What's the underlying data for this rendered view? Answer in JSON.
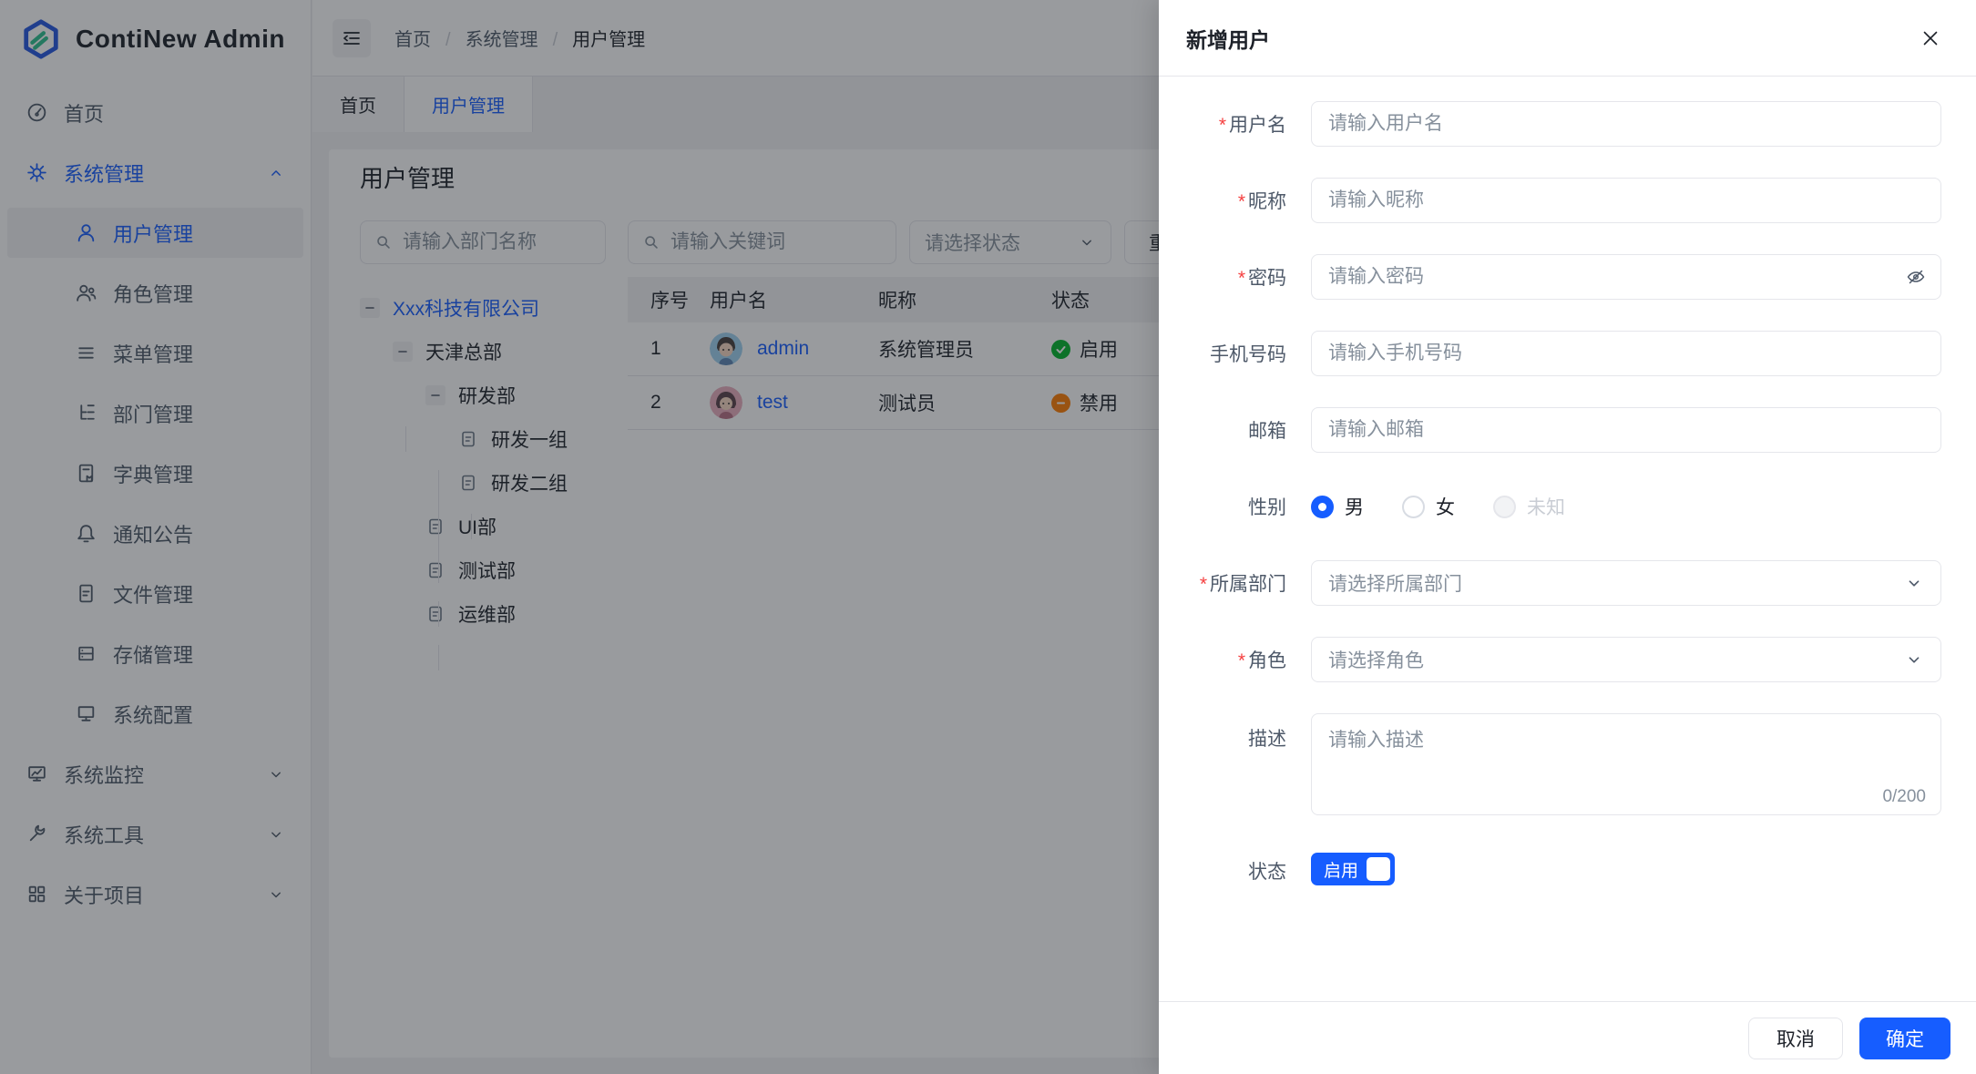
{
  "app": {
    "title": "ContiNew Admin"
  },
  "colors": {
    "primary": "#165DFF",
    "success": "#00B42A",
    "warning": "#FF7D00",
    "danger": "#F53F3F"
  },
  "sidebar": {
    "items": [
      {
        "label": "首页"
      },
      {
        "label": "系统管理"
      },
      {
        "label": "用户管理"
      },
      {
        "label": "角色管理"
      },
      {
        "label": "菜单管理"
      },
      {
        "label": "部门管理"
      },
      {
        "label": "字典管理"
      },
      {
        "label": "通知公告"
      },
      {
        "label": "文件管理"
      },
      {
        "label": "存储管理"
      },
      {
        "label": "系统配置"
      },
      {
        "label": "系统监控"
      },
      {
        "label": "系统工具"
      },
      {
        "label": "关于项目"
      }
    ]
  },
  "header": {
    "breadcrumb": [
      "首页",
      "系统管理",
      "用户管理"
    ]
  },
  "tabs": [
    {
      "label": "首页"
    },
    {
      "label": "用户管理"
    }
  ],
  "page": {
    "title": "用户管理",
    "dept_search_placeholder": "请输入部门名称",
    "tree": [
      {
        "label": "Xxx科技有限公司"
      },
      {
        "label": "天津总部"
      },
      {
        "label": "研发部"
      },
      {
        "label": "研发一组"
      },
      {
        "label": "研发二组"
      },
      {
        "label": "UI部"
      },
      {
        "label": "测试部"
      },
      {
        "label": "运维部"
      }
    ],
    "toolbar": {
      "keyword_placeholder": "请输入关键词",
      "status_placeholder": "请选择状态",
      "reset": "重置"
    },
    "table": {
      "columns": [
        "序号",
        "用户名",
        "昵称",
        "状态"
      ],
      "rows": [
        {
          "index": "1",
          "username": "admin",
          "nickname": "系统管理员",
          "status": "启用"
        },
        {
          "index": "2",
          "username": "test",
          "nickname": "测试员",
          "status": "禁用"
        }
      ]
    }
  },
  "drawer": {
    "title": "新增用户",
    "username": {
      "label": "用户名",
      "placeholder": "请输入用户名"
    },
    "nickname": {
      "label": "昵称",
      "placeholder": "请输入昵称"
    },
    "password": {
      "label": "密码",
      "placeholder": "请输入密码"
    },
    "phone": {
      "label": "手机号码",
      "placeholder": "请输入手机号码"
    },
    "email": {
      "label": "邮箱",
      "placeholder": "请输入邮箱"
    },
    "gender": {
      "label": "性别",
      "options": [
        {
          "label": "男"
        },
        {
          "label": "女"
        },
        {
          "label": "未知"
        }
      ]
    },
    "dept": {
      "label": "所属部门",
      "placeholder": "请选择所属部门"
    },
    "role": {
      "label": "角色",
      "placeholder": "请选择角色"
    },
    "description": {
      "label": "描述",
      "placeholder": "请输入描述",
      "counter": "0/200"
    },
    "status": {
      "label": "状态",
      "switch_label": "启用"
    },
    "cancel": "取消",
    "confirm": "确定"
  }
}
